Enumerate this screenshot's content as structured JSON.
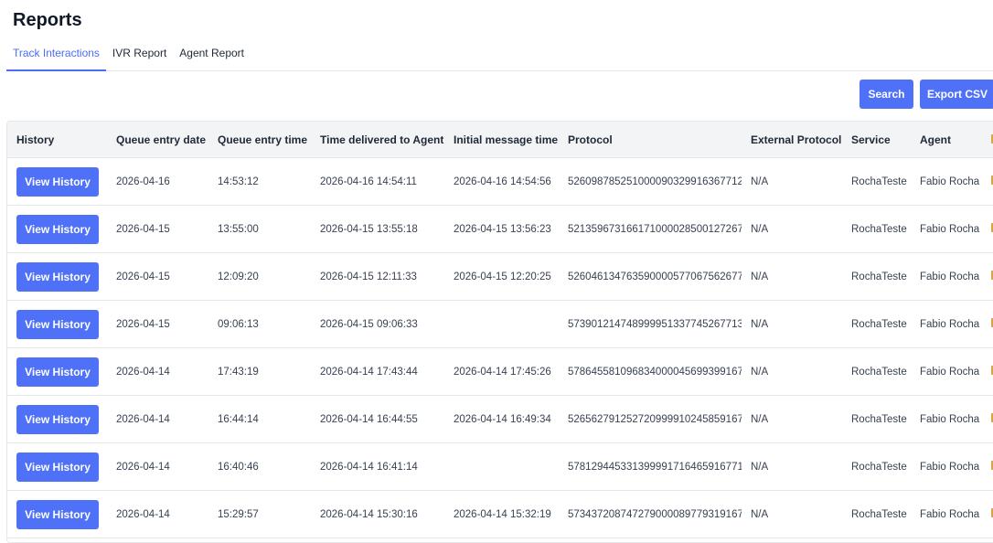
{
  "page": {
    "title": "Reports"
  },
  "tabs": [
    {
      "label": "Track Interactions",
      "active": true
    },
    {
      "label": "IVR Report",
      "active": false
    },
    {
      "label": "Agent Report",
      "active": false
    }
  ],
  "actions": {
    "search_label": "Search",
    "export_label": "Export CSV"
  },
  "colors": {
    "accent": "#4e71f8",
    "active_tab": "#4b6cf5"
  },
  "table": {
    "columns": [
      "History",
      "Queue entry date",
      "Queue entry time",
      "Time delivered to Agent",
      "Initial message time",
      "Protocol",
      "External Protocol",
      "Service",
      "Agent"
    ],
    "action_label": "View History",
    "rows": [
      {
        "date": "2026-04-16",
        "time": "14:53:12",
        "delivered": "2026-04-16 14:54:11",
        "initial": "2026-04-16 14:54:56",
        "protocol": "526098785251000090329916367712",
        "external": "N/A",
        "service": "RochaTeste",
        "agent": "Fabio Rocha"
      },
      {
        "date": "2026-04-15",
        "time": "13:55:00",
        "delivered": "2026-04-15 13:55:18",
        "initial": "2026-04-15 13:56:23",
        "protocol": "521359673166171000028500127267",
        "external": "N/A",
        "service": "RochaTeste",
        "agent": "Fabio Rocha"
      },
      {
        "date": "2026-04-15",
        "time": "12:09:20",
        "delivered": "2026-04-15 12:11:33",
        "initial": "2026-04-15 12:20:25",
        "protocol": "526046134763590000577067562677",
        "external": "N/A",
        "service": "RochaTeste",
        "agent": "Fabio Rocha"
      },
      {
        "date": "2026-04-15",
        "time": "09:06:13",
        "delivered": "2026-04-15 09:06:33",
        "initial": "",
        "protocol": "573901214748999951337745267713",
        "external": "N/A",
        "service": "RochaTeste",
        "agent": "Fabio Rocha"
      },
      {
        "date": "2026-04-14",
        "time": "17:43:19",
        "delivered": "2026-04-14 17:43:44",
        "initial": "2026-04-14 17:45:26",
        "protocol": "578645581096834000045699399167",
        "external": "N/A",
        "service": "RochaTeste",
        "agent": "Fabio Rocha"
      },
      {
        "date": "2026-04-14",
        "time": "16:44:14",
        "delivered": "2026-04-14 16:44:55",
        "initial": "2026-04-14 16:49:34",
        "protocol": "526562791252720999910245859167",
        "external": "N/A",
        "service": "RochaTeste",
        "agent": "Fabio Rocha"
      },
      {
        "date": "2026-04-14",
        "time": "16:40:46",
        "delivered": "2026-04-14 16:41:14",
        "initial": "",
        "protocol": "578129445331399991716465916771",
        "external": "N/A",
        "service": "RochaTeste",
        "agent": "Fabio Rocha"
      },
      {
        "date": "2026-04-14",
        "time": "15:29:57",
        "delivered": "2026-04-14 15:30:16",
        "initial": "2026-04-14 15:32:19",
        "protocol": "573437208747279000089779319167",
        "external": "N/A",
        "service": "RochaTeste",
        "agent": "Fabio Rocha"
      }
    ]
  }
}
